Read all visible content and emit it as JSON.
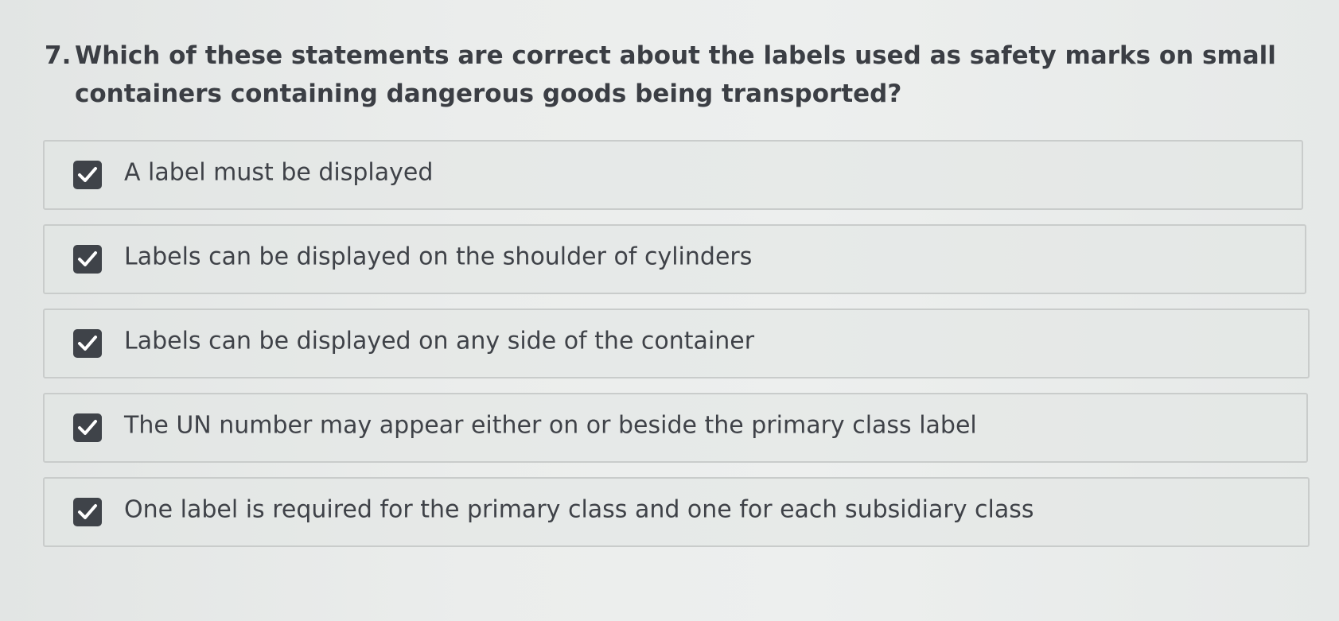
{
  "question": {
    "number": "7.",
    "text": "Which of these statements are correct about the labels used as safety marks on small containers containing dangerous goods being transported?"
  },
  "options": [
    {
      "label": "A label must be displayed",
      "checked": true
    },
    {
      "label": "Labels can be displayed on the shoulder of cylinders",
      "checked": true
    },
    {
      "label": "Labels can be displayed on any side of the container",
      "checked": true
    },
    {
      "label": "The UN number may appear either on or beside the primary class label",
      "checked": true
    },
    {
      "label": "One label is required for the primary class and one for each subsidiary class",
      "checked": true
    }
  ],
  "colors": {
    "checkbox_fill": "#3f4349",
    "checkmark": "#ffffff",
    "text": "#3d4046",
    "option_border": "#c9cccb"
  }
}
